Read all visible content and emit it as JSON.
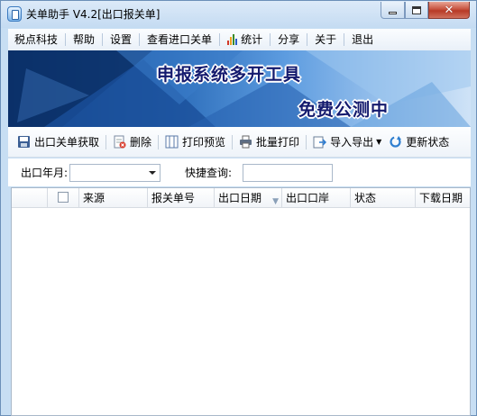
{
  "window": {
    "title": "关单助手  V4.2[出口报关单]"
  },
  "menu": [
    {
      "label": "税点科技"
    },
    {
      "label": "帮助"
    },
    {
      "label": "设置"
    },
    {
      "label": "查看进口关单"
    },
    {
      "label": "统计",
      "icon": "bar-chart-icon"
    },
    {
      "label": "分享"
    },
    {
      "label": "关于"
    },
    {
      "label": "退出"
    }
  ],
  "banner": {
    "title": "申报系统多开工具",
    "subtitle": "免费公测中"
  },
  "toolbar": {
    "fetch": "出口关单获取",
    "delete": "删除",
    "print_preview": "打印预览",
    "batch_print": "批量打印",
    "import_export": "导入导出",
    "refresh_status": "更新状态"
  },
  "filters": {
    "month_label": "出口年月:",
    "month_value": "",
    "quick_label": "快捷查询:",
    "quick_value": ""
  },
  "table": {
    "columns": [
      "来源",
      "报关单号",
      "出口日期",
      "出口口岸",
      "状态",
      "下载日期"
    ],
    "rows": []
  },
  "colors": {
    "accent": "#1d4f91",
    "banner_text": "#141a6e",
    "close_button": "#c8533f"
  }
}
